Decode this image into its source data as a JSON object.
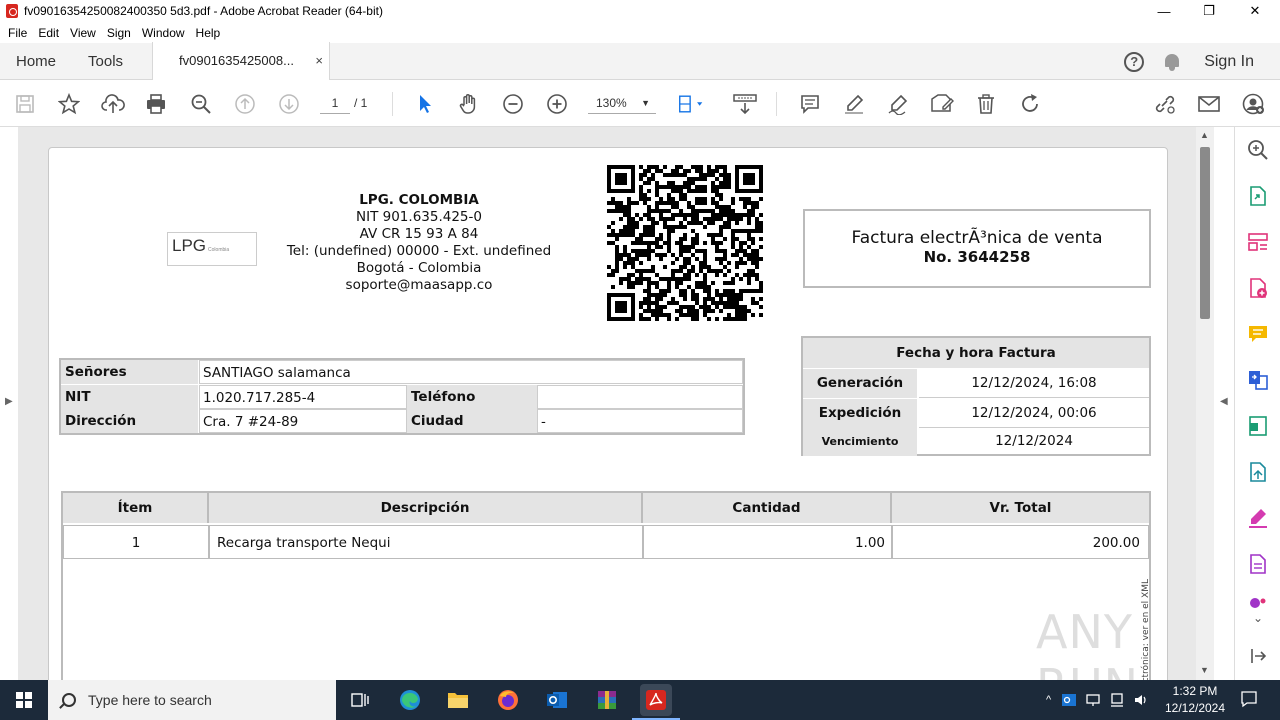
{
  "window": {
    "title": "fv09016354250082400350 5d3.pdf - Adobe Acrobat Reader (64-bit)",
    "controls": {
      "minimize": "—",
      "maximize": "❐",
      "close": "✕"
    }
  },
  "menu": [
    "File",
    "Edit",
    "View",
    "Sign",
    "Window",
    "Help"
  ],
  "tabs": {
    "home": "Home",
    "tools": "Tools",
    "document": "fv0901635425008...",
    "close": "×",
    "sign_in": "Sign In",
    "help": "?"
  },
  "toolbar": {
    "page_current": "1",
    "page_total": "/ 1",
    "zoom": "130%",
    "zoom_caret": "▼"
  },
  "invoice": {
    "logo_text": "LPG",
    "logo_sub": "Colombia",
    "company_name": "LPG. COLOMBIA",
    "company_nit": "NIT 901.635.425-0",
    "company_address": "AV CR 15 93 A 84",
    "company_phone": "Tel: (undefined) 00000 - Ext. undefined",
    "company_city": "Bogotá - Colombia",
    "company_email": "soporte@maasapp.co",
    "doc_title": "Factura electrÃ³nica de venta",
    "doc_number": "No. 3644258",
    "client": {
      "senores_label": "Señores",
      "senores_value": "SANTIAGO salamanca",
      "nit_label": "NIT",
      "nit_value": "1.020.717.285-4",
      "telefono_label": "Teléfono",
      "telefono_value": "",
      "direccion_label": "Dirección",
      "direccion_value": "Cra. 7 #24-89",
      "ciudad_label": "Ciudad",
      "ciudad_value": "-"
    },
    "dates": {
      "header": "Fecha y hora Factura",
      "generacion_label": "Generación",
      "generacion_value": "12/12/2024, 16:08",
      "expedicion_label": "Expedición",
      "expedicion_value": "12/12/2024, 00:06",
      "vencimiento_label": "Vencimiento",
      "vencimiento_value": "12/12/2024"
    },
    "items_headers": {
      "item": "Ítem",
      "descripcion": "Descripción",
      "cantidad": "Cantidad",
      "total": "Vr. Total"
    },
    "items": [
      {
        "item": "1",
        "descripcion": "Recarga transporte Nequi",
        "cantidad": "1.00",
        "total": "200.00"
      }
    ],
    "side_note": "electrónica: ver en el XML"
  },
  "watermark": "ANY RUN",
  "taskbar": {
    "search_placeholder": "Type here to search",
    "time": "1:32 PM",
    "date": "12/12/2024"
  },
  "colors": {
    "acrobat_red": "#d7271f",
    "taskbar_bg": "#1c2a3a",
    "tool_blue": "#1473e6",
    "rightbar_pink": "#e0337a"
  }
}
